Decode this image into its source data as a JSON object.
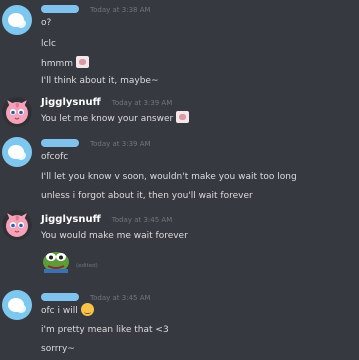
{
  "messages": {
    "group1": {
      "username": "",
      "timestamp": "Today at 3:38 AM",
      "lines": [
        "o?",
        "lclc",
        "hmmm",
        "I'll think about it, maybe~"
      ]
    },
    "group2": {
      "username": "Jigglysnuff",
      "timestamp": "Today at 3:39 AM",
      "lines": [
        "You let me know your answer"
      ]
    },
    "group3": {
      "username": "",
      "timestamp": "Today at 3:39 AM",
      "lines": [
        "ofcofc",
        "I'll let you know v soon, wouldn't make you wait too long",
        "unless i forgot about it, then you'll wait forever"
      ]
    },
    "group4": {
      "username": "Jigglysnuff",
      "timestamp": "Today at 3:45 AM",
      "lines": [
        "You would make me wait forever"
      ],
      "edited_label": "(edited)"
    },
    "group5": {
      "username": "",
      "timestamp": "Today at 3:45 AM",
      "lines": [
        "ofc i will",
        "i'm pretty mean like that <3",
        "sorrry~"
      ]
    }
  },
  "icons": {
    "avatar_other": "cloud-avatar-icon",
    "avatar_jiggly": "jigglypuff-avatar-icon",
    "emoji_sticker": "pink-sticker-emoji-icon",
    "emoji_pepe": "pepe-emoji-icon",
    "emoji_grimace": "grimace-emoji-icon"
  },
  "colors": {
    "background": "#36393f",
    "text": "#dcddde",
    "username": "#ffffff",
    "timestamp": "#72767d",
    "redacted": "#7fc2ee"
  }
}
